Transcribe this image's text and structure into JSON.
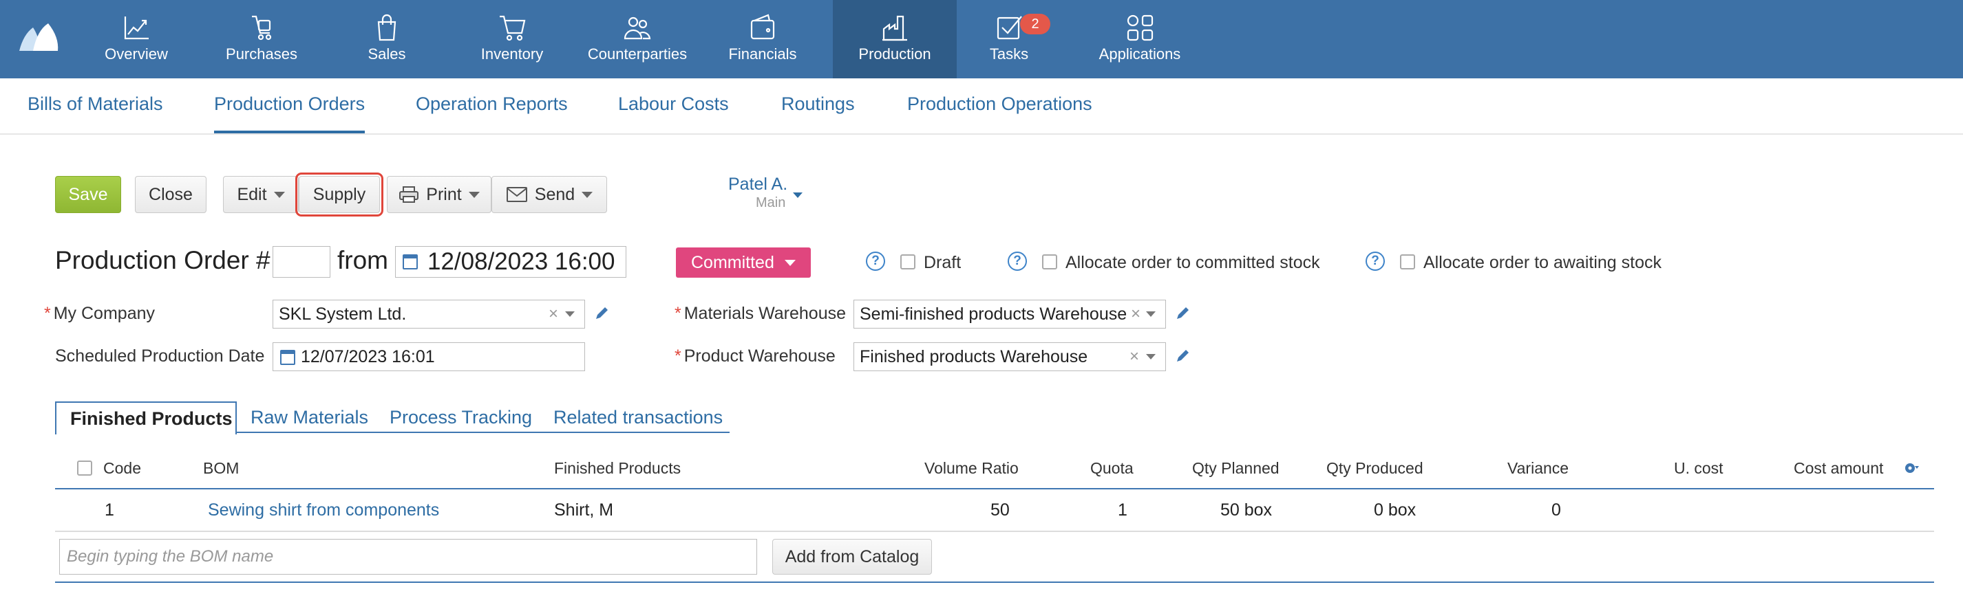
{
  "colors": {
    "nav_bg": "#3d71a6",
    "nav_active": "#2f5c88",
    "link": "#2e6da4",
    "save": "#9bc33d",
    "status": "#e0467e",
    "highlight": "#e0463b"
  },
  "topnav": {
    "items": [
      {
        "label": "Overview",
        "icon": "chart-line-icon"
      },
      {
        "label": "Purchases",
        "icon": "shopping-bags-icon"
      },
      {
        "label": "Sales",
        "icon": "shopping-bag-icon"
      },
      {
        "label": "Inventory",
        "icon": "cart-icon"
      },
      {
        "label": "Counterparties",
        "icon": "people-icon"
      },
      {
        "label": "Financials",
        "icon": "wallet-icon"
      },
      {
        "label": "Production",
        "icon": "factory-icon",
        "active": true
      },
      {
        "label": "Tasks",
        "icon": "checkbox-icon",
        "badge": "2"
      },
      {
        "label": "Applications",
        "icon": "apps-grid-icon"
      }
    ]
  },
  "subnav": {
    "tabs": [
      {
        "label": "Bills of Materials"
      },
      {
        "label": "Production Orders",
        "active": true
      },
      {
        "label": "Operation Reports"
      },
      {
        "label": "Labour Costs"
      },
      {
        "label": "Routings"
      },
      {
        "label": "Production Operations"
      }
    ]
  },
  "toolbar": {
    "save": "Save",
    "close": "Close",
    "edit": "Edit",
    "supply": "Supply",
    "print": "Print",
    "send": "Send"
  },
  "user": {
    "name": "Patel A.",
    "context": "Main"
  },
  "order": {
    "title": "Production Order #",
    "number": "",
    "from_label": "from",
    "date": "12/08/2023 16:00",
    "status": "Committed",
    "draft_label": "Draft",
    "allocate_committed_label": "Allocate order to committed stock",
    "allocate_awaiting_label": "Allocate order to awaiting stock"
  },
  "form": {
    "company_label": "My Company",
    "company_value": "SKL System Ltd.",
    "scheduled_label": "Scheduled Production Date",
    "scheduled_value": "12/07/2023 16:01",
    "materials_wh_label": "Materials Warehouse",
    "materials_wh_value": "Semi-finished products Warehouse",
    "product_wh_label": "Product Warehouse",
    "product_wh_value": "Finished products Warehouse"
  },
  "tabs": [
    {
      "label": "Finished Products",
      "active": true
    },
    {
      "label": "Raw Materials"
    },
    {
      "label": "Process Tracking"
    },
    {
      "label": "Related transactions"
    }
  ],
  "table": {
    "columns": [
      "Code",
      "BOM",
      "Finished Products",
      "Volume Ratio",
      "Quota",
      "Qty Planned",
      "Qty Produced",
      "Variance",
      "U. cost",
      "Cost amount"
    ],
    "rows": [
      {
        "code": "1",
        "bom": "Sewing shirt from components",
        "product": "Shirt, M",
        "volume_ratio": "50",
        "quota": "1",
        "qty_planned": "50 box",
        "qty_produced": "0 box",
        "variance": "0",
        "unit_cost": "",
        "cost_amount": ""
      }
    ],
    "bom_placeholder": "Begin typing the BOM name",
    "add_from_catalog": "Add from Catalog"
  }
}
